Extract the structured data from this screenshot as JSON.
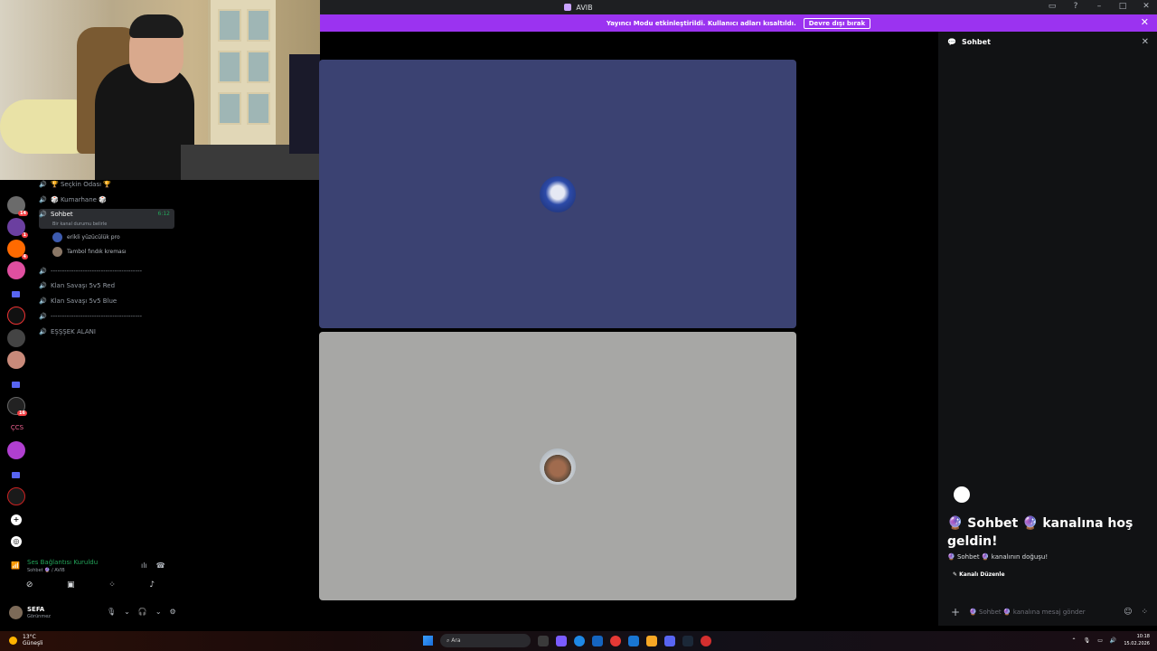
{
  "window": {
    "title": "AVIB"
  },
  "banner": {
    "text": "Yayıncı Modu etkinleştirildi. Kullanıcı adları kısaltıldı.",
    "button": "Devre dışı bırak",
    "close_icon": "close-icon"
  },
  "channels": {
    "items": [
      {
        "name": "🏆 Seçkin Odası 🏆",
        "active": false
      },
      {
        "name": "🎲 Kumarhane 🎲",
        "active": false
      },
      {
        "name": "Sohbet",
        "active": true,
        "time": "6:12",
        "status": "Bir kanal durumu belirle"
      },
      {
        "name": "----------------------------------------",
        "active": false
      },
      {
        "name": "Klan Savaşı 5v5 Red",
        "active": false
      },
      {
        "name": "Klan Savaşı 5v5 Blue",
        "active": false
      },
      {
        "name": "----------------------------------------",
        "active": false
      },
      {
        "name": "EŞŞŞEK ALANI",
        "active": false
      }
    ],
    "voice_users": [
      {
        "name": "erikli yüzücülük pro"
      },
      {
        "name": "Tambol fındık kreması"
      }
    ]
  },
  "voice_panel": {
    "status": "Ses Bağlantısı Kuruldu",
    "channel": "Sohbet 🔮 / AVIB"
  },
  "user_panel": {
    "name": "SEFA",
    "status": "Görünmez"
  },
  "server_list": {
    "badges": [
      "14",
      "1",
      "4",
      "16"
    ],
    "text_label": "ÇCS"
  },
  "chat": {
    "header": "Sohbet",
    "welcome": "🔮 Sohbet 🔮 kanalına hoş geldin!",
    "origin": "🔮 Sohbet 🔮 kanalının doğuşu!",
    "edit_button": "Kanalı Düzenle",
    "input_placeholder": "🔮 Sohbet 🔮 kanalına mesaj gönder"
  },
  "taskbar": {
    "temperature": "13°C",
    "weather": "Güneşli",
    "search_label": "Ara",
    "time": "10:18",
    "date": "15.02.2026"
  },
  "colors": {
    "banner": "#9b33f0",
    "tile1": "#3b4272",
    "tile2": "#a7a7a5",
    "connected": "#23a55a"
  }
}
